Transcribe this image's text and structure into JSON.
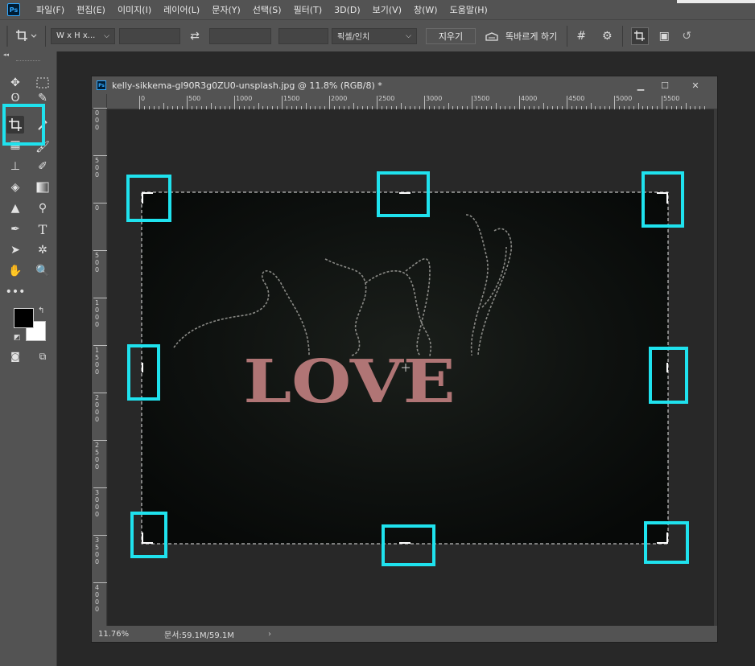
{
  "app": {
    "logo_text": "Ps"
  },
  "menu": [
    "파일(F)",
    "편집(E)",
    "이미지(I)",
    "레이어(L)",
    "문자(Y)",
    "선택(S)",
    "필터(T)",
    "3D(D)",
    "보기(V)",
    "창(W)",
    "도움말(H)"
  ],
  "options": {
    "crop_icon": "crop-icon",
    "ratio_label": "W x H x...",
    "width_value": "",
    "height_value": "",
    "resolution_value": "",
    "unit_label": "픽셀/인치",
    "clear_label": "지우기",
    "straighten_label": "똑바르게 하기"
  },
  "document": {
    "title": "kelly-sikkema-gl90R3g0ZU0-unsplash.jpg @ 11.8% (RGB/8) *",
    "zoom": "11.76%",
    "doc_size": "문서:59.1M/59.1M",
    "ruler_top_labels": [
      "0",
      "500",
      "1000",
      "1500",
      "2000",
      "2500",
      "3000",
      "3500",
      "4000",
      "4500",
      "5000",
      "5500"
    ],
    "ruler_left_labels": [
      "0\n0\n0",
      "5\n0\n0",
      "0",
      "5\n0\n0",
      "1\n0\n0\n0",
      "1\n5\n0\n0",
      "2\n0\n0\n0",
      "2\n5\n0\n0",
      "3\n0\n0\n0",
      "3\n5\n0\n0",
      "4\n0\n0\n0",
      "4"
    ],
    "image_text": "LOVE"
  },
  "colors": {
    "ui_panel": "#535353",
    "highlight": "#1fe2ee",
    "foreground": "#000000",
    "background": "#ffffff",
    "letters": "#b07575"
  }
}
